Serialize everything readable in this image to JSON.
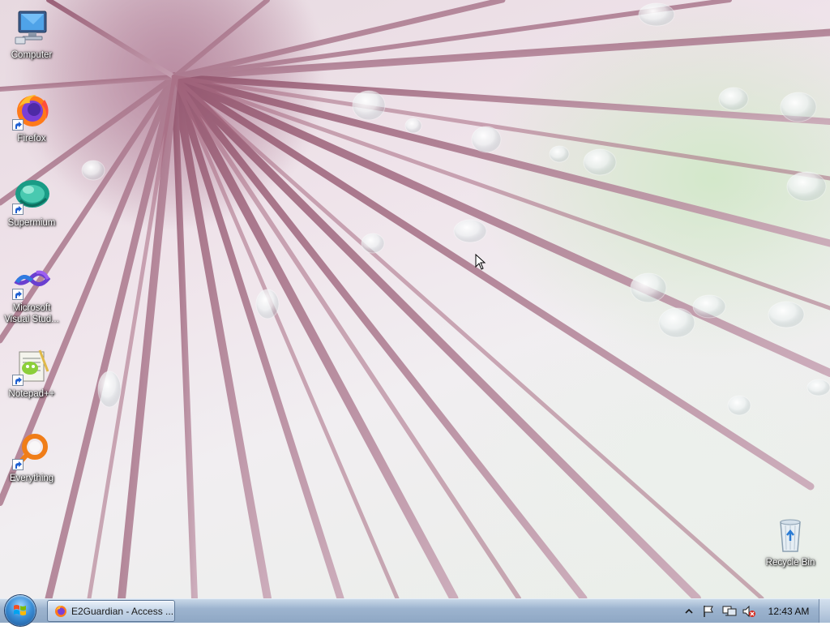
{
  "desktop": {
    "icons": [
      {
        "label": "Computer",
        "icon": "computer-icon",
        "shortcut": false
      },
      {
        "label": "Firefox",
        "icon": "firefox-icon",
        "shortcut": true
      },
      {
        "label": "Supermium",
        "icon": "supermium-icon",
        "shortcut": true
      },
      {
        "label": "Microsoft\nVisual Stud...",
        "icon": "visual-studio-icon",
        "shortcut": true
      },
      {
        "label": "Notepad++",
        "icon": "notepad-plus-plus-icon",
        "shortcut": true
      },
      {
        "label": "Everything",
        "icon": "everything-search-icon",
        "shortcut": true
      }
    ],
    "recycle_bin": {
      "label": "Recycle Bin",
      "icon": "recycle-bin-icon"
    }
  },
  "taskbar": {
    "start_button": {
      "icon": "windows-start-orb-icon"
    },
    "tasks": [
      {
        "label": "E2Guardian - Access ...",
        "icon": "firefox-icon"
      }
    ],
    "tray": {
      "icons": [
        "show-hidden-icons-chevron",
        "action-center-flag-icon",
        "network-icon",
        "volume-muted-icon"
      ],
      "clock": "12:43 AM"
    }
  },
  "colors": {
    "taskbar": "#9db4cf",
    "icon_label": "#ffffff",
    "wallpaper_stem": "#8a5566"
  }
}
